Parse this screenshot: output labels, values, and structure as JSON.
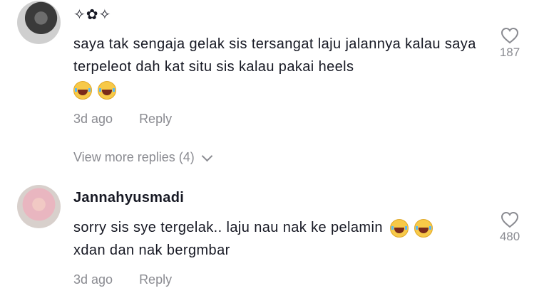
{
  "comments": [
    {
      "username": "✧✿✧",
      "text": "saya tak sengaja gelak sis tersangat laju jalannya kalau saya terpeleot dah kat situ sis kalau pakai heels",
      "emojis": [
        "face-with-tears-of-joy",
        "face-with-tears-of-joy"
      ],
      "time": "3d ago",
      "reply_label": "Reply",
      "likes": "187",
      "view_more": "View more replies (4)"
    },
    {
      "username": "Jannahyusmadi",
      "text": "sorry sis sye tergelak.. laju nau nak ke pelamin",
      "text2": "xdan dan nak bergmbar",
      "emojis": [
        "face-with-tears-of-joy",
        "face-with-tears-of-joy"
      ],
      "time": "3d ago",
      "reply_label": "Reply",
      "likes": "480"
    }
  ],
  "colors": {
    "text": "#161823",
    "muted": "#8a8b91",
    "background": "#ffffff"
  }
}
